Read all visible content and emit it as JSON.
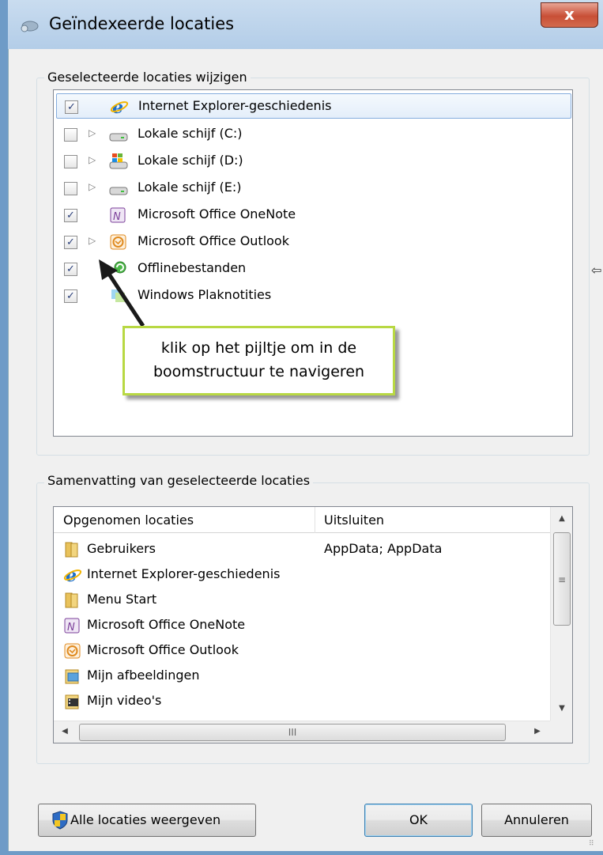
{
  "window": {
    "title": "Geïndexeerde locaties",
    "close_label": "x"
  },
  "locations_group": {
    "legend": "Geselecteerde locaties wijzigen",
    "items": [
      {
        "label": "Internet Explorer-geschiedenis",
        "checked": "✓",
        "expander": "",
        "icon": "internet-explorer-icon"
      },
      {
        "label": "Lokale schijf (C:)",
        "checked": "",
        "expander": "▷",
        "icon": "hard-drive-icon"
      },
      {
        "label": "Lokale schijf (D:)",
        "checked": "",
        "expander": "▷",
        "icon": "windows-drive-icon"
      },
      {
        "label": "Lokale schijf (E:)",
        "checked": "",
        "expander": "▷",
        "icon": "hard-drive-icon"
      },
      {
        "label": "Microsoft Office OneNote",
        "checked": "✓",
        "expander": "",
        "icon": "onenote-icon"
      },
      {
        "label": "Microsoft Office Outlook",
        "checked": "✓",
        "expander": "▷",
        "icon": "outlook-icon"
      },
      {
        "label": "Offlinebestanden",
        "checked": "✓",
        "expander": "",
        "icon": "offline-files-icon"
      },
      {
        "label": "Windows Plaknotities",
        "checked": "✓",
        "expander": "",
        "icon": "sticky-notes-icon"
      }
    ],
    "callout": "klik op het pijltje om in de boomstructuur te navigeren"
  },
  "summary_group": {
    "legend": "Samenvatting van geselecteerde locaties",
    "columns": [
      "Opgenomen locaties",
      "Uitsluiten"
    ],
    "rows": [
      {
        "name": "Gebruikers",
        "exclude": "AppData; AppData",
        "icon": "folder-icon"
      },
      {
        "name": "Internet Explorer-geschiedenis",
        "exclude": "",
        "icon": "internet-explorer-icon"
      },
      {
        "name": "Menu Start",
        "exclude": "",
        "icon": "folder-icon"
      },
      {
        "name": "Microsoft Office OneNote",
        "exclude": "",
        "icon": "onenote-icon"
      },
      {
        "name": "Microsoft Office Outlook",
        "exclude": "",
        "icon": "outlook-icon"
      },
      {
        "name": "Mijn afbeeldingen",
        "exclude": "",
        "icon": "pictures-folder-icon"
      },
      {
        "name": "Mijn video's",
        "exclude": "",
        "icon": "videos-folder-icon"
      }
    ],
    "scroll_glyphs": {
      "up": "▲",
      "down": "▼",
      "left": "◀",
      "right": "▶",
      "thumb_v": "≡",
      "thumb_h": "III"
    }
  },
  "buttons": {
    "show_all": "Alle locaties weergeven",
    "ok": "OK",
    "cancel": "Annuleren"
  },
  "colors": {
    "callout_border": "#b8d843",
    "selection": "#84acdd",
    "titlebar": "#b3cde8"
  }
}
